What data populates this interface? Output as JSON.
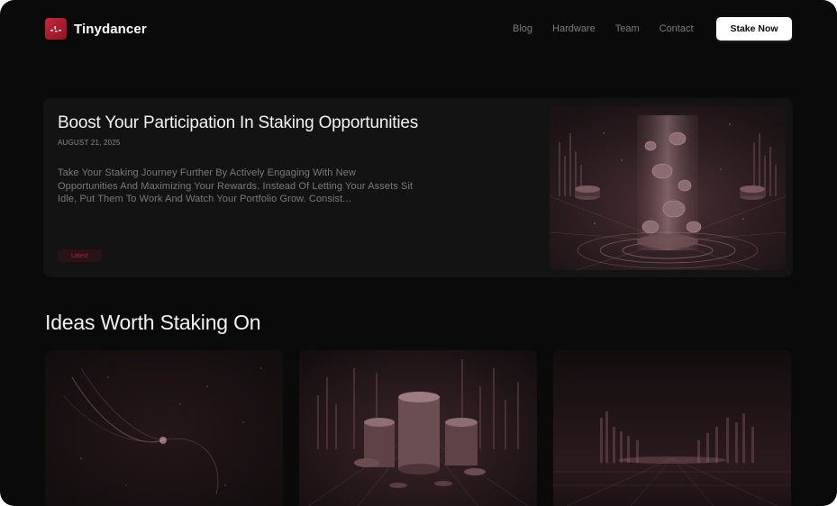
{
  "brand": {
    "name": "Tinydancer",
    "accent": "#c8263a"
  },
  "nav": {
    "items": [
      {
        "label": "Blog"
      },
      {
        "label": "Hardware"
      },
      {
        "label": "Team"
      },
      {
        "label": "Contact"
      }
    ],
    "cta_label": "Stake Now"
  },
  "featured": {
    "title": "Boost Your Participation In Staking Opportunities",
    "date": "AUGUST 21, 2025",
    "excerpt": "Take Your Staking Journey Further By Actively Engaging With New Opportunities And Maximizing Your Rewards. Instead Of Letting Your Assets Sit Idle, Put Them To Work And Watch Your Portfolio Grow. Consist...",
    "badge": "Latest",
    "image_icon": "coins-pedestal-illustration"
  },
  "section": {
    "title": "Ideas Worth Staking On"
  },
  "cards": [
    {
      "image_icon": "particle-swirl-illustration"
    },
    {
      "image_icon": "coin-stacks-illustration"
    },
    {
      "image_icon": "bar-city-illustration"
    }
  ]
}
